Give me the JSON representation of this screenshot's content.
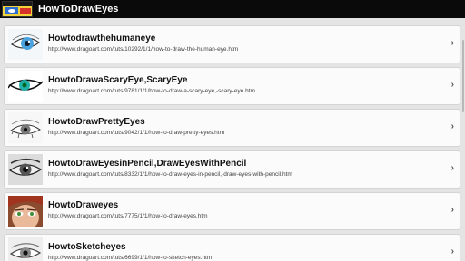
{
  "app": {
    "title": "HowToDrawEyes"
  },
  "items": [
    {
      "title": "Howtodrawthehumaneye",
      "url": "http://www.dragoart.com/tuts/10292/1/1/how-to-draw-the-human-eye.htm",
      "icon": "eye-blue-icon"
    },
    {
      "title": "HowtoDrawaScaryEye,ScaryEye",
      "url": "http://www.dragoart.com/tuts/9781/1/1/how-to-draw-a-scary-eye,-scary-eye.htm",
      "icon": "eye-teal-icon"
    },
    {
      "title": "HowtoDrawPrettyEyes",
      "url": "http://www.dragoart.com/tuts/9042/1/1/how-to-draw-pretty-eyes.htm",
      "icon": "eye-sketch-icon"
    },
    {
      "title": "HowtoDrawEyesinPencil,DrawEyesWithPencil",
      "url": "http://www.dragoart.com/tuts/8332/1/1/how-to-draw-eyes-in-pencil,-draw-eyes-with-pencil.htm",
      "icon": "eye-pencil-icon"
    },
    {
      "title": "HowtoDraweyes",
      "url": "http://www.dragoart.com/tuts/7775/1/1/how-to-draw-eyes.htm",
      "icon": "face-icon"
    },
    {
      "title": "HowtoSketcheyes",
      "url": "http://www.dragoart.com/tuts/6699/1/1/how-to-sketch-eyes.htm",
      "icon": "eye-gray-icon"
    }
  ],
  "chevron": "›"
}
